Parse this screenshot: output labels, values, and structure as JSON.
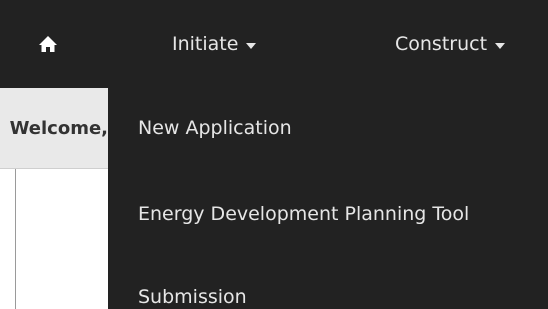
{
  "navbar": {
    "home_icon": "home-icon",
    "items": [
      {
        "label": "Initiate"
      },
      {
        "label": "Construct"
      }
    ]
  },
  "welcome": {
    "text": "Welcome,"
  },
  "dropdown": {
    "items": [
      {
        "label": "New Application"
      },
      {
        "label": "Energy Development Planning Tool"
      },
      {
        "label": "Submission"
      }
    ]
  },
  "colors": {
    "navbar_bg": "#222222",
    "nav_text": "#e6e6e6",
    "welcome_bg": "#e9e9e9"
  }
}
